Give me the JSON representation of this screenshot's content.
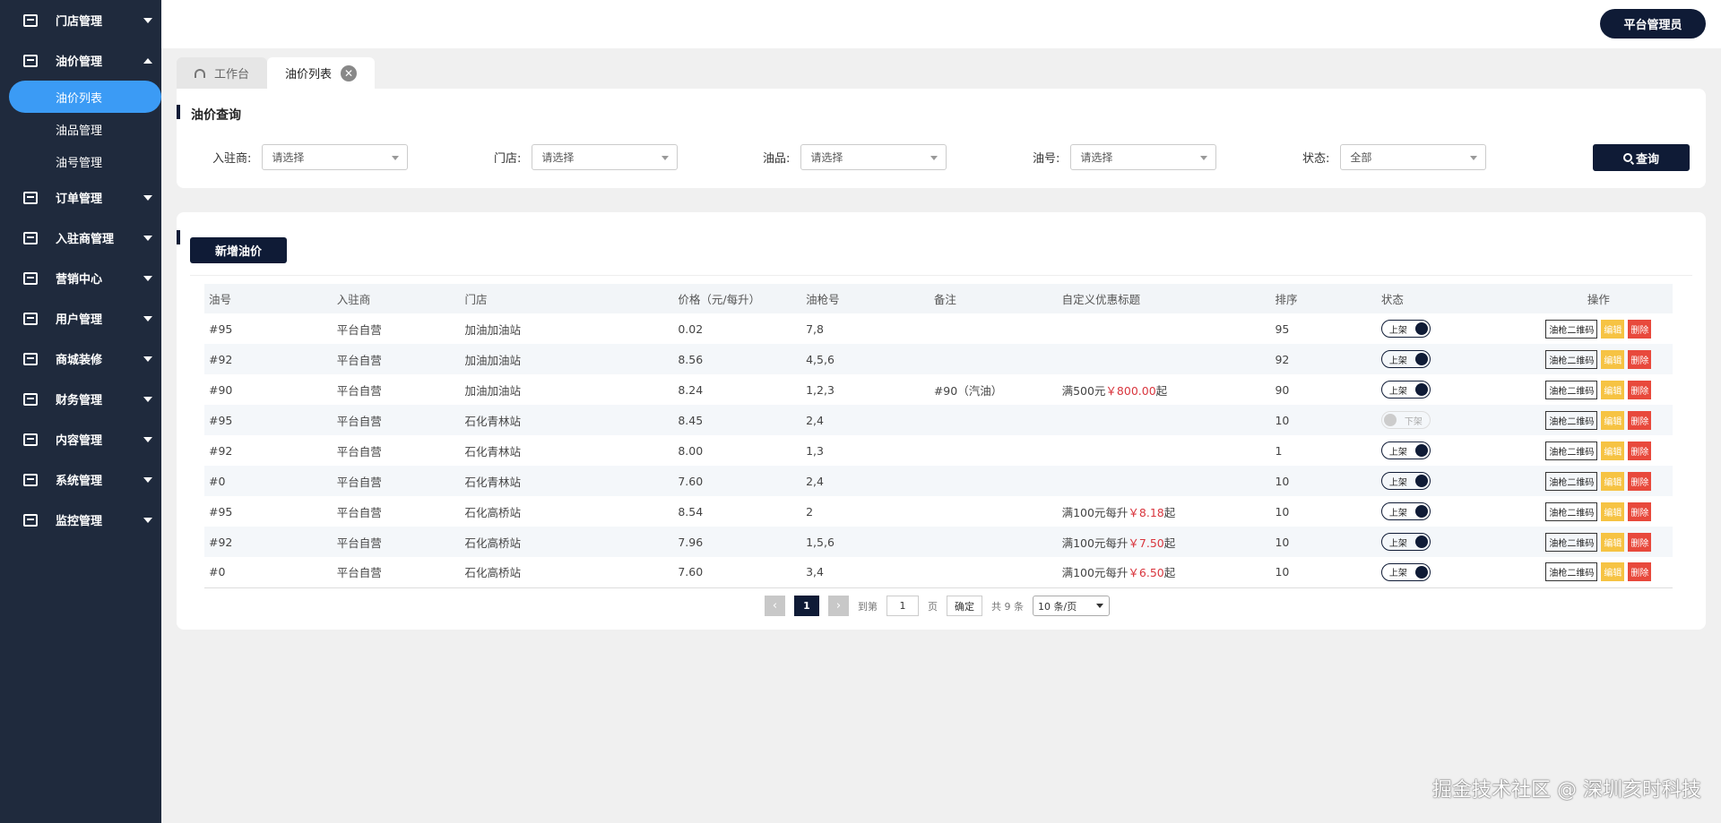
{
  "sidebar": {
    "items": [
      {
        "label": "门店管理"
      },
      {
        "label": "油价管理",
        "sub": [
          {
            "label": "油价列表"
          },
          {
            "label": "油品管理"
          },
          {
            "label": "油号管理"
          }
        ]
      },
      {
        "label": "订单管理"
      },
      {
        "label": "入驻商管理"
      },
      {
        "label": "营销中心"
      },
      {
        "label": "用户管理"
      },
      {
        "label": "商城装修"
      },
      {
        "label": "财务管理"
      },
      {
        "label": "内容管理"
      },
      {
        "label": "系统管理"
      },
      {
        "label": "监控管理"
      }
    ]
  },
  "header": {
    "admin_label": "平台管理员"
  },
  "tabs": [
    {
      "label": "工作台"
    },
    {
      "label": "油价列表"
    }
  ],
  "query": {
    "title": "油价查询",
    "filters": [
      {
        "label": "入驻商:",
        "value": "请选择"
      },
      {
        "label": "门店:",
        "value": "请选择"
      },
      {
        "label": "油品:",
        "value": "请选择"
      },
      {
        "label": "油号:",
        "value": "请选择"
      },
      {
        "label": "状态:",
        "value": "全部"
      }
    ],
    "button": "查询"
  },
  "list": {
    "add_button": "新增油价",
    "columns": [
      "油号",
      "入驻商",
      "门店",
      "价格（元/每升）",
      "油枪号",
      "备注",
      "自定义优惠标题",
      "排序",
      "状态",
      "操作"
    ],
    "rows": [
      {
        "oil": "#95",
        "merchant": "平台自营",
        "store": "加油加油站",
        "price": "0.02",
        "guns": "7,8",
        "note": "",
        "promo_pre": "",
        "promo_price": "",
        "promo_post": "",
        "sort": "95",
        "status": "上架",
        "on": true
      },
      {
        "oil": "#92",
        "merchant": "平台自营",
        "store": "加油加油站",
        "price": "8.56",
        "guns": "4,5,6",
        "note": "",
        "promo_pre": "",
        "promo_price": "",
        "promo_post": "",
        "sort": "92",
        "status": "上架",
        "on": true
      },
      {
        "oil": "#90",
        "merchant": "平台自营",
        "store": "加油加油站",
        "price": "8.24",
        "guns": "1,2,3",
        "note": "#90（汽油）",
        "promo_pre": "满500元",
        "promo_price": "￥800.00",
        "promo_post": "起",
        "sort": "90",
        "status": "上架",
        "on": true
      },
      {
        "oil": "#95",
        "merchant": "平台自营",
        "store": "石化青林站",
        "price": "8.45",
        "guns": "2,4",
        "note": "",
        "promo_pre": "",
        "promo_price": "",
        "promo_post": "",
        "sort": "10",
        "status": "下架",
        "on": false
      },
      {
        "oil": "#92",
        "merchant": "平台自营",
        "store": "石化青林站",
        "price": "8.00",
        "guns": "1,3",
        "note": "",
        "promo_pre": "",
        "promo_price": "",
        "promo_post": "",
        "sort": "1",
        "status": "上架",
        "on": true
      },
      {
        "oil": "#0",
        "merchant": "平台自营",
        "store": "石化青林站",
        "price": "7.60",
        "guns": "2,4",
        "note": "",
        "promo_pre": "",
        "promo_price": "",
        "promo_post": "",
        "sort": "10",
        "status": "上架",
        "on": true
      },
      {
        "oil": "#95",
        "merchant": "平台自营",
        "store": "石化高桥站",
        "price": "8.54",
        "guns": "2",
        "note": "",
        "promo_pre": "满100元每升",
        "promo_price": "￥8.18",
        "promo_post": "起",
        "sort": "10",
        "status": "上架",
        "on": true
      },
      {
        "oil": "#92",
        "merchant": "平台自营",
        "store": "石化高桥站",
        "price": "7.96",
        "guns": "1,5,6",
        "note": "",
        "promo_pre": "满100元每升",
        "promo_price": "￥7.50",
        "promo_post": "起",
        "sort": "10",
        "status": "上架",
        "on": true
      },
      {
        "oil": "#0",
        "merchant": "平台自营",
        "store": "石化高桥站",
        "price": "7.60",
        "guns": "3,4",
        "note": "",
        "promo_pre": "满100元每升",
        "promo_price": "￥6.50",
        "promo_post": "起",
        "sort": "10",
        "status": "上架",
        "on": true
      }
    ],
    "ops": {
      "qr": "油枪二维码",
      "edit": "编辑",
      "del": "删除"
    }
  },
  "pager": {
    "prev": "‹",
    "page": "1",
    "next": "›",
    "goto_label": "到第",
    "goto_value": "1",
    "page_unit": "页",
    "ok": "确定",
    "total": "共 9 条",
    "size": "10 条/页"
  },
  "watermark": "掘金技术社区 @ 深圳亥时科技"
}
